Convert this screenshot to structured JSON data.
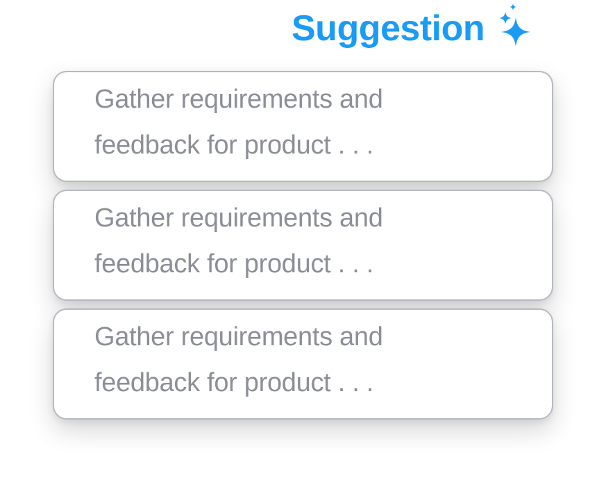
{
  "header": {
    "title": "Suggestion",
    "icon": "sparkle-icon",
    "accent_color": "#1a9bf6"
  },
  "suggestions": [
    {
      "line1": "Gather requirements and",
      "line2": "feedback for product . . ."
    },
    {
      "line1": "Gather requirements and",
      "line2": "feedback for product . . ."
    },
    {
      "line1": "Gather requirements and",
      "line2": "feedback for product . . ."
    }
  ]
}
